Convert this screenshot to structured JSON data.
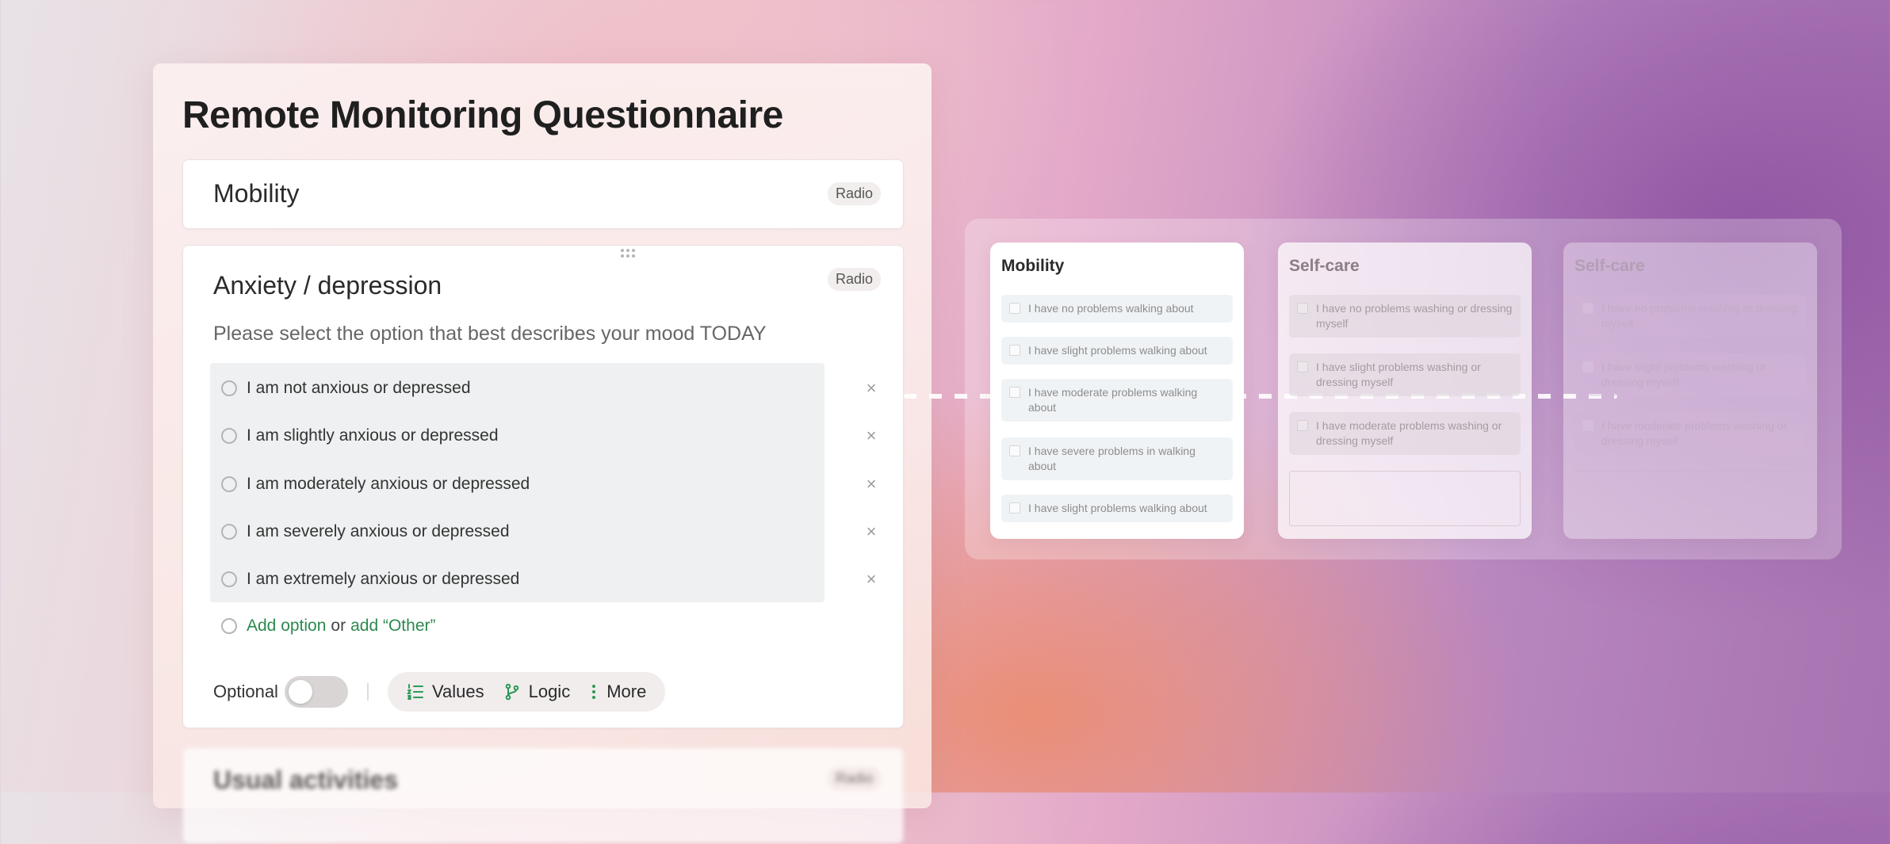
{
  "page_title": "Remote Monitoring Questionnaire",
  "cards": {
    "mobility": {
      "title": "Mobility",
      "badge": "Radio"
    },
    "anxiety": {
      "title": "Anxiety / depression",
      "badge": "Radio",
      "question": "Please select the option that best describes your mood TODAY",
      "options": [
        "I am not anxious or depressed",
        "I am slightly anxious or depressed",
        "I am moderately anxious or depressed",
        "I am severely anxious or depressed",
        "I am extremely anxious or depressed"
      ],
      "remove_symbol": "×",
      "add_option": "Add option",
      "add_or": "or",
      "add_other": "add “Other”",
      "optional_label": "Optional",
      "tools": {
        "values": "Values",
        "logic": "Logic",
        "more": "More"
      }
    },
    "usual_activities": {
      "title": "Usual activities",
      "badge": "Radio"
    }
  },
  "preview": {
    "cards": [
      {
        "title": "Mobility",
        "items": [
          "I have no problems walking about",
          "I have slight problems walking about",
          "I have moderate problems walking about",
          "I have severe problems in walking about",
          "I have slight problems walking about"
        ]
      },
      {
        "title": "Self-care",
        "items": [
          "I have no problems washing or dressing myself",
          "I have slight problems washing or dressing myself",
          "I have moderate problems washing or dressing myself"
        ]
      },
      {
        "title": "Self-care",
        "items": [
          "I have no problems washing or dressing myself",
          "I have slight problems washing or dressing myself",
          "I have moderate problems washing or dressing myself"
        ]
      }
    ]
  },
  "colors": {
    "accent_green": "#2c8a4e",
    "title_text": "#1f1f1f",
    "option_box": "#eef0f1"
  },
  "icons": {
    "values": "numbered-list-icon",
    "logic": "branch-icon",
    "more": "vertical-dots-icon",
    "remove": "close-icon",
    "drag": "drag-handle-icon"
  }
}
